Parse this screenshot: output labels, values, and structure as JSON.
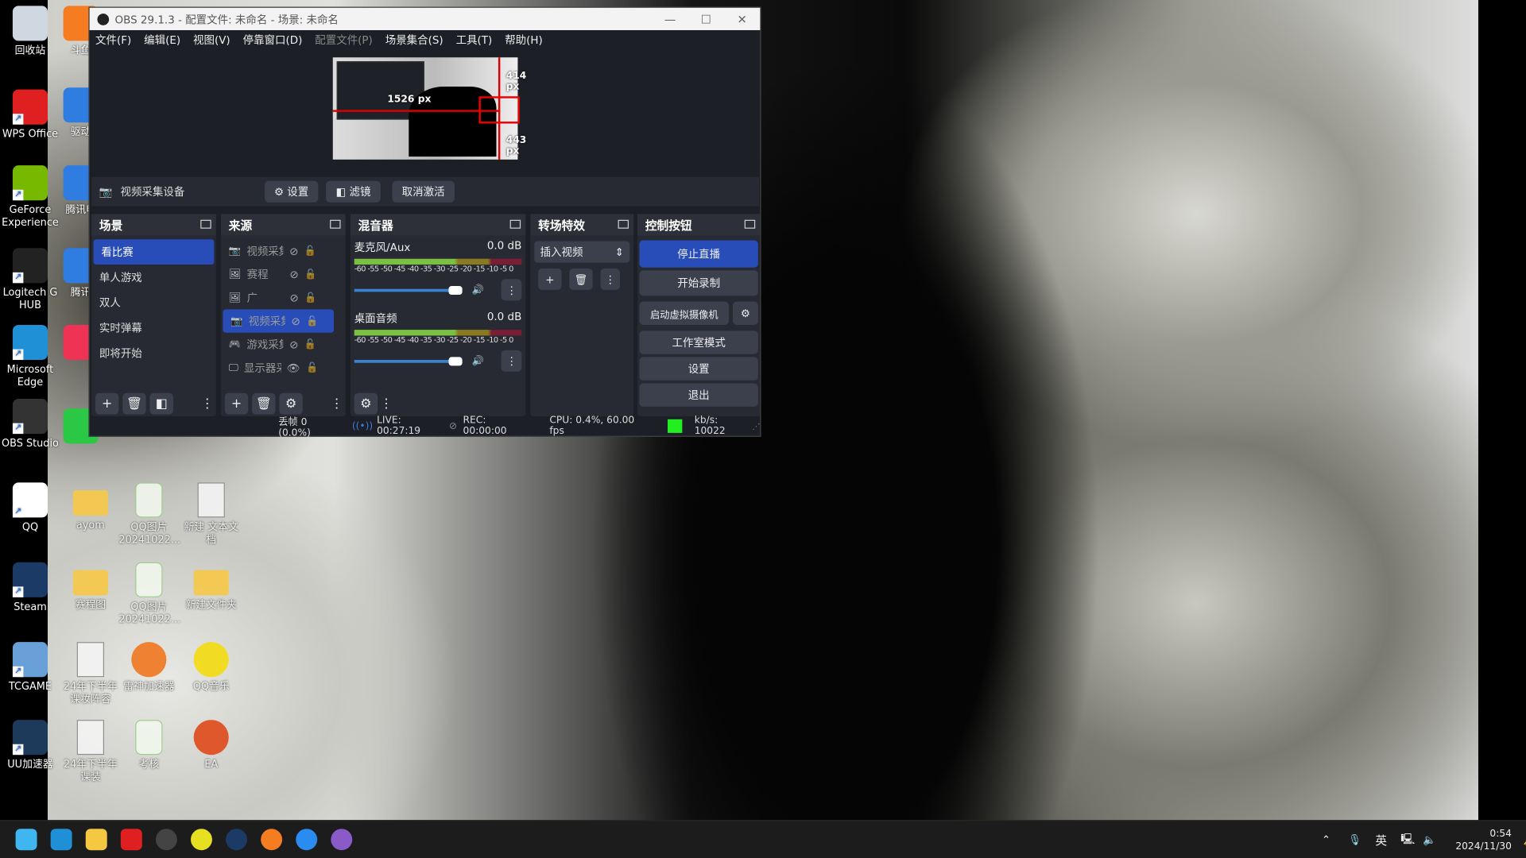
{
  "desktop": {
    "left_icons": [
      {
        "label": "回收站",
        "icon": "recycle-bin-icon",
        "color": "#cfd8e0"
      },
      {
        "label": "WPS Office",
        "icon": "wps-icon",
        "color": "#e02020"
      },
      {
        "label": "GeForce Experience",
        "icon": "nvidia-icon",
        "color": "#76b900"
      },
      {
        "label": "Logitech G HUB",
        "icon": "logitech-icon",
        "color": "#222222"
      },
      {
        "label": "Microsoft Edge",
        "icon": "edge-icon",
        "color": "#1f8fd6"
      },
      {
        "label": "OBS Studio",
        "icon": "obs-icon",
        "color": "#333333"
      },
      {
        "label": "QQ",
        "icon": "qq-icon",
        "color": "#ffffff"
      },
      {
        "label": "Steam",
        "icon": "steam-icon",
        "color": "#1b3a66"
      },
      {
        "label": "TCGAME",
        "icon": "tcgame-icon",
        "color": "#6aa0d8"
      },
      {
        "label": "UU加速器",
        "icon": "uu-icon",
        "color": "#1e3a5a"
      }
    ],
    "second_column": [
      {
        "label": "斗鱼",
        "icon": "douyu-icon",
        "color": "#f57c20"
      },
      {
        "label": "驱动",
        "icon": "driver-icon",
        "color": "#2f7de1"
      },
      {
        "label": "腾讯电",
        "icon": "tencent-pc-icon",
        "color": "#2f7de1"
      },
      {
        "label": "腾讯",
        "icon": "tencent-icon",
        "color": "#2f7de1"
      },
      {
        "label": "",
        "icon": "app-icon",
        "color": "#ee3355"
      },
      {
        "label": "",
        "icon": "wechat-icon",
        "color": "#2ac845"
      }
    ],
    "grid_icons": [
      {
        "label": "ayom",
        "icon": "folder-icon"
      },
      {
        "label": "QQ图片20241022...",
        "icon": "png-file-icon"
      },
      {
        "label": "新建 文本文档",
        "icon": "text-file-icon"
      },
      {
        "label": "赛程图",
        "icon": "folder-icon"
      },
      {
        "label": "QQ图片20241022...",
        "icon": "png-file-icon"
      },
      {
        "label": "新建文件夹",
        "icon": "folder-icon"
      },
      {
        "label": "24年下半年课妆阵容",
        "icon": "text-file-icon"
      },
      {
        "label": "雷神加速器",
        "icon": "leishen-icon"
      },
      {
        "label": "QQ音乐",
        "icon": "qqmusic-icon"
      },
      {
        "label": "24年下半年课装",
        "icon": "text-file-icon"
      },
      {
        "label": "考核",
        "icon": "png-file-icon"
      },
      {
        "label": "EA",
        "icon": "ea-icon"
      }
    ]
  },
  "obs": {
    "title": "OBS 29.1.3 - 配置文件: 未命名 - 场景: 未命名",
    "menu": [
      "文件(F)",
      "编辑(E)",
      "视图(V)",
      "停靠窗口(D)",
      "配置文件(P)",
      "场景集合(S)",
      "工具(T)",
      "帮助(H)"
    ],
    "preview": {
      "top_label": "414 px",
      "left_label": "1526 px",
      "bottom_label": "443 px"
    },
    "source_bar": {
      "name": "视频采集设备",
      "settings": "设置",
      "filters": "滤镜",
      "deactivate": "取消激活"
    },
    "scenes": {
      "title": "场景",
      "items": [
        "看比赛",
        "单人游戏",
        "双人",
        "实时弹幕",
        "即将开始"
      ],
      "selected": 0
    },
    "sources": {
      "title": "来源",
      "items": [
        {
          "name": "视频采集",
          "icon": "camera-icon",
          "visible": false
        },
        {
          "name": "赛程",
          "icon": "image-icon",
          "visible": false
        },
        {
          "name": "广",
          "icon": "image-icon",
          "visible": false
        },
        {
          "name": "视频采集",
          "icon": "camera-icon",
          "visible": false
        },
        {
          "name": "游戏采集",
          "icon": "gamepad-icon",
          "visible": false
        },
        {
          "name": "显示器采集",
          "icon": "monitor-icon",
          "visible": true
        }
      ],
      "selected": 3
    },
    "mixer": {
      "title": "混音器",
      "scale": "-60 -55 -50 -45 -40 -35 -30 -25 -20 -15 -10 -5 0",
      "channels": [
        {
          "name": "麦克风/Aux",
          "db": "0.0 dB",
          "volume": 100
        },
        {
          "name": "桌面音频",
          "db": "0.0 dB",
          "volume": 100
        }
      ]
    },
    "transitions": {
      "title": "转场特效",
      "selected": "插入视频"
    },
    "controls": {
      "title": "控制按钮",
      "stream": "停止直播",
      "record": "开始录制",
      "virtualcam": "启动虚拟摄像机",
      "studio": "工作室模式",
      "settings": "设置",
      "exit": "退出",
      "accent": "#284cb8"
    },
    "status": {
      "dropped": "丢帧 0 (0.0%)",
      "live": "LIVE: 00:27:19",
      "rec": "REC: 00:00:00",
      "cpu": "CPU: 0.4%, 60.00 fps",
      "kbps": "kb/s: 10022",
      "health_color": "#22ee22"
    }
  },
  "taskbar": {
    "apps": [
      {
        "icon": "windows-start-icon",
        "color": "#3fb6f0"
      },
      {
        "icon": "edge-icon",
        "color": "#1f8fd6"
      },
      {
        "icon": "file-explorer-icon",
        "color": "#f5c842"
      },
      {
        "icon": "wps-icon",
        "color": "#e02020"
      },
      {
        "icon": "obs-icon",
        "color": "#444444"
      },
      {
        "icon": "ring-app-icon",
        "color": "#e6e020"
      },
      {
        "icon": "steam-icon",
        "color": "#1b3a66"
      },
      {
        "icon": "douyu-icon",
        "color": "#f57c20"
      },
      {
        "icon": "qq-browser-icon",
        "color": "#2a8cf0"
      },
      {
        "icon": "media-player-icon",
        "color": "#8a5ac8"
      }
    ],
    "ime": "英",
    "time": "0:54",
    "date": "2024/11/30"
  }
}
